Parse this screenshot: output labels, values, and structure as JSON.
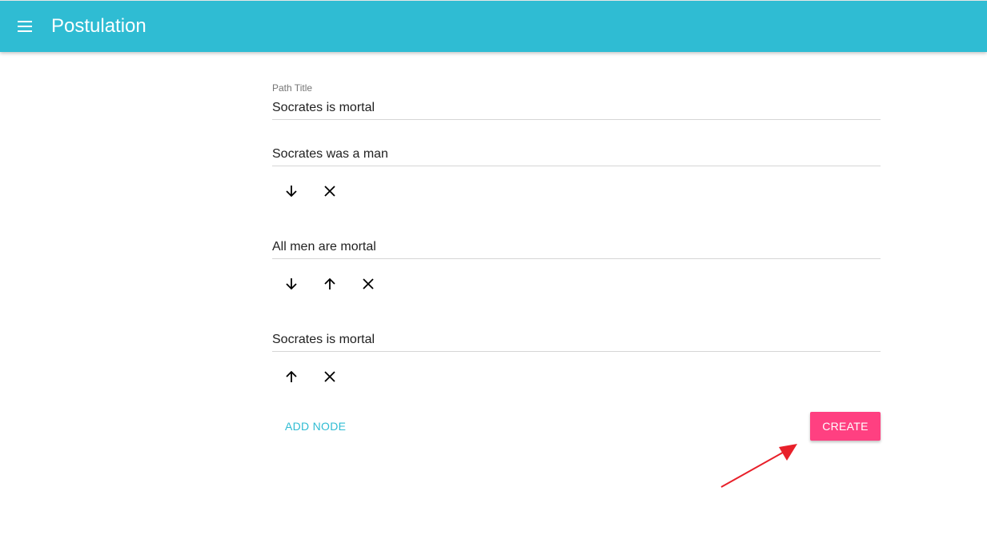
{
  "app": {
    "title": "Postulation",
    "menu_icon": "menu-icon",
    "bar_color": "#2fbcd3"
  },
  "path_title": {
    "label": "Path Title",
    "value": "Socrates is mortal"
  },
  "nodes": [
    {
      "value": "Socrates was a man",
      "actions": [
        "arrow-down-icon",
        "close-icon"
      ]
    },
    {
      "value": "All men are mortal",
      "actions": [
        "arrow-down-icon",
        "arrow-up-icon",
        "close-icon"
      ]
    },
    {
      "value": "Socrates is mortal",
      "actions": [
        "arrow-up-icon",
        "close-icon"
      ]
    }
  ],
  "actions": {
    "add_node_label": "ADD NODE",
    "create_label": "CREATE",
    "create_color": "#ff4081"
  },
  "annotation": {
    "arrow_color": "#e8202a"
  }
}
